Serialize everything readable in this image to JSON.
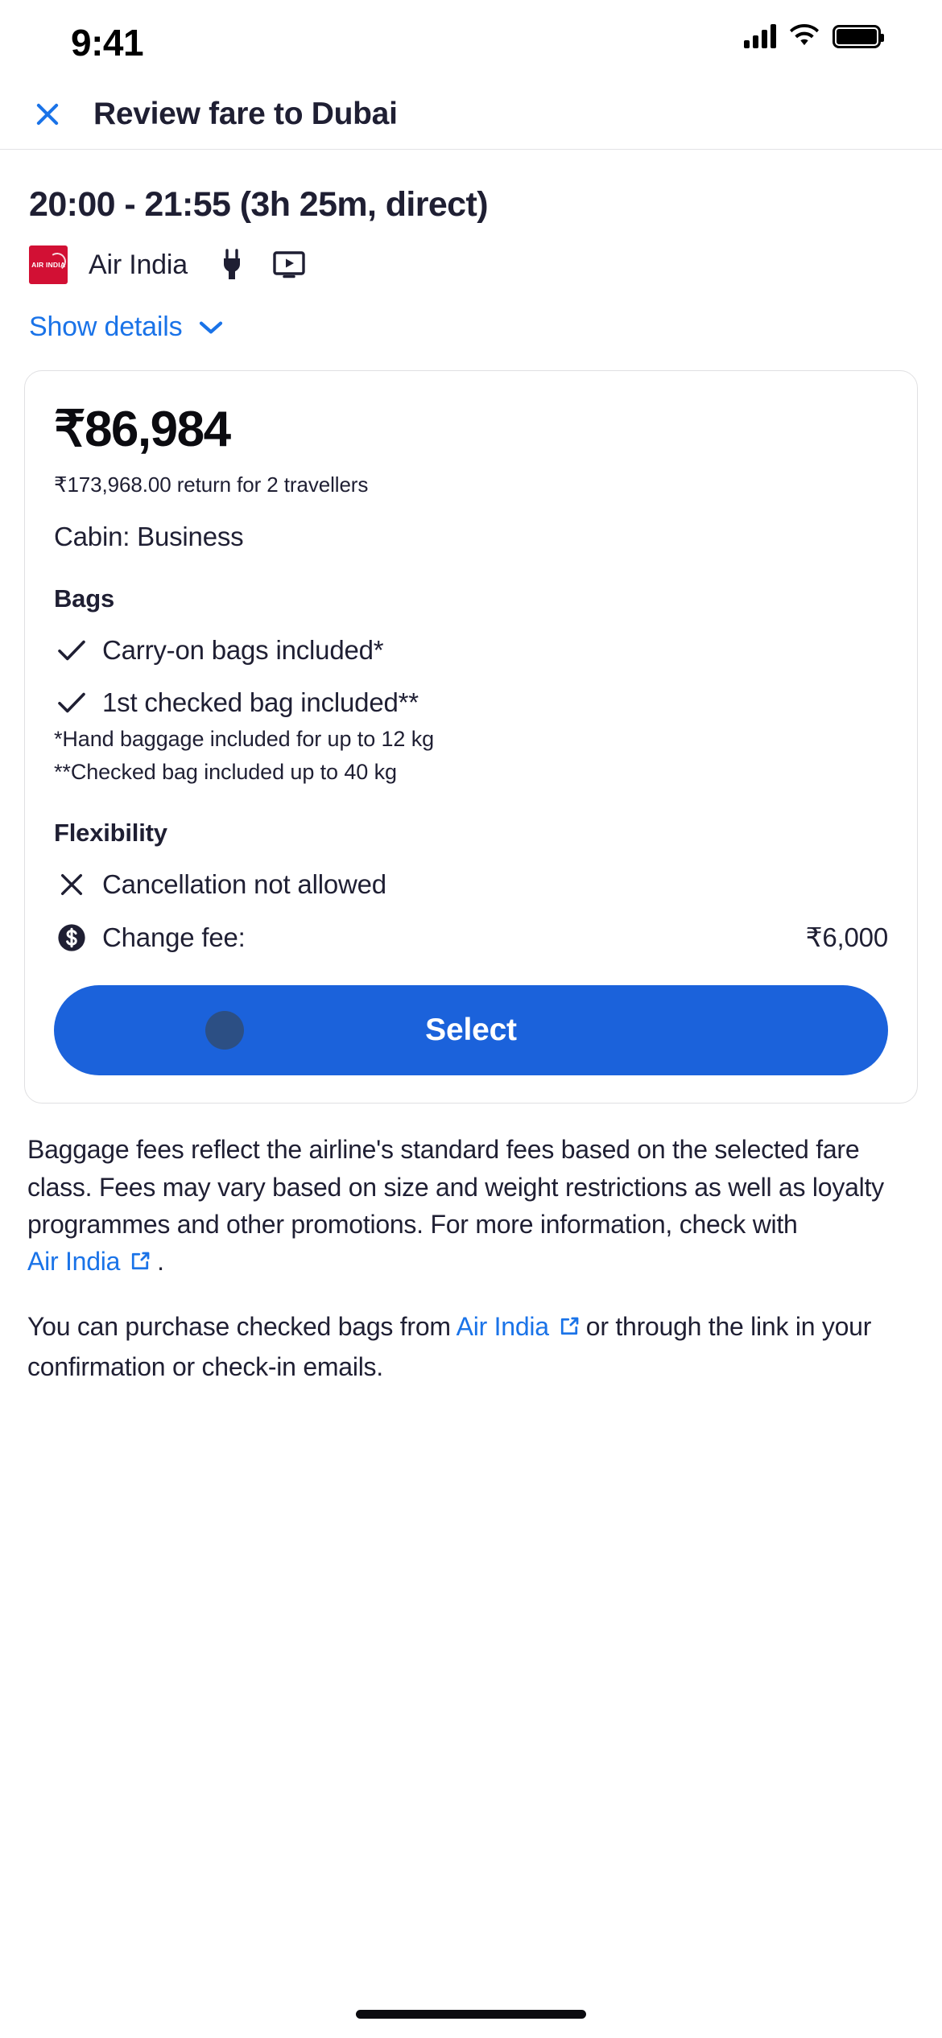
{
  "status_bar": {
    "time": "9:41",
    "signal_icon": "cellular-signal-icon",
    "wifi_icon": "wifi-icon",
    "battery_icon": "battery-icon"
  },
  "app_bar": {
    "close_icon": "close-icon",
    "title": "Review fare to Dubai"
  },
  "flight": {
    "times": "20:00 - 21:55 (3h 25m, direct)",
    "airline_logo_text": "AIR INDIA",
    "airline_name": "Air India",
    "amenities": [
      {
        "icon": "power-outlet-icon",
        "name": "In-seat power"
      },
      {
        "icon": "in-flight-entertainment-icon",
        "name": "On-demand video"
      }
    ],
    "show_details_label": "Show details",
    "show_details_icon": "chevron-down-icon"
  },
  "fare_card": {
    "price": "₹86,984",
    "price_sub": "₹173,968.00 return for 2 travellers",
    "cabin": "Cabin: Business",
    "bags_title": "Bags",
    "bags": [
      {
        "icon": "check-icon",
        "label": "Carry-on bags included*"
      },
      {
        "icon": "check-icon",
        "label": "1st checked bag included**"
      }
    ],
    "bag_footnotes": [
      "*Hand baggage included for up to 12 kg",
      "**Checked bag included up to 40 kg"
    ],
    "flexibility_title": "Flexibility",
    "flexibility": [
      {
        "icon": "x-icon",
        "label": "Cancellation not allowed",
        "value": ""
      },
      {
        "icon": "dollar-coin-icon",
        "label": "Change fee:",
        "value": "₹6,000"
      }
    ],
    "select_label": "Select"
  },
  "disclaimer": {
    "paragraph1_part1": "Baggage fees reflect the airline's standard fees based on the selected fare class. Fees may vary based on size and weight restrictions as well as loyalty programmes and other promotions. For more information, check with ",
    "paragraph1_link": "Air India",
    "paragraph1_part2": ".",
    "paragraph2_part1": "You can purchase checked bags from ",
    "paragraph2_link": "Air India",
    "paragraph2_part2": "or through the link in your confirmation or check-in emails.",
    "external_link_icon": "external-link-icon"
  },
  "system": {
    "home_indicator": "home-indicator"
  },
  "colors": {
    "accent_blue": "#1a73e8",
    "button_blue": "#1b62db",
    "text_dark": "#1f1f33",
    "airline_red": "#d21034"
  }
}
